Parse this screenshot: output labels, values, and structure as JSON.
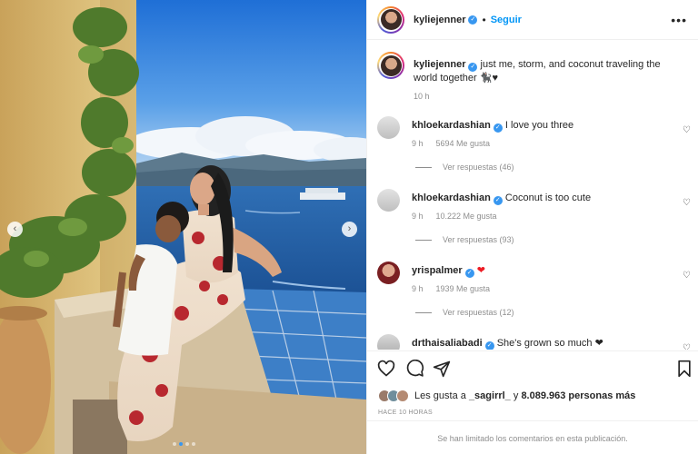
{
  "post": {
    "username": "kyliejenner",
    "follow_label": "Seguir",
    "more_label": "•••",
    "separator": "•"
  },
  "caption": {
    "username": "kyliejenner",
    "text": "just me, storm, and coconut traveling the world together 🐈‍⬛♥",
    "time": "10 h"
  },
  "comments": [
    {
      "username": "khloekardashian",
      "text": "I love you three",
      "time": "9 h",
      "likes": "5694 Me gusta",
      "replies": "Ver respuestas (46)"
    },
    {
      "username": "khloekardashian",
      "text": "Coconut is too cute",
      "time": "9 h",
      "likes": "10.222 Me gusta",
      "replies": "Ver respuestas (93)"
    },
    {
      "username": "yrispalmer",
      "text": "❤",
      "time": "9 h",
      "likes": "1939 Me gusta",
      "replies": "Ver respuestas (12)"
    },
    {
      "username": "drthaisaliabadi",
      "text": "She's grown so much ❤"
    }
  ],
  "likes": {
    "prefix": "Les gusta a ",
    "user": "_sagirrl_",
    "middle": " y ",
    "count": "8.089.963 personas más"
  },
  "posted_label": "HACE 10 HORAS",
  "comments_limited": "Se han limitado los comentarios en esta publicación.",
  "carousel": {
    "total": 4,
    "active": 2
  },
  "colors": {
    "accent": "#0095f6",
    "verified": "#3897f0",
    "heart": "#ed1c24",
    "muted": "#8e8e8e"
  },
  "icons": [
    "heart-icon",
    "comment-icon",
    "share-icon",
    "bookmark-icon",
    "verified-icon",
    "more-options-icon"
  ]
}
